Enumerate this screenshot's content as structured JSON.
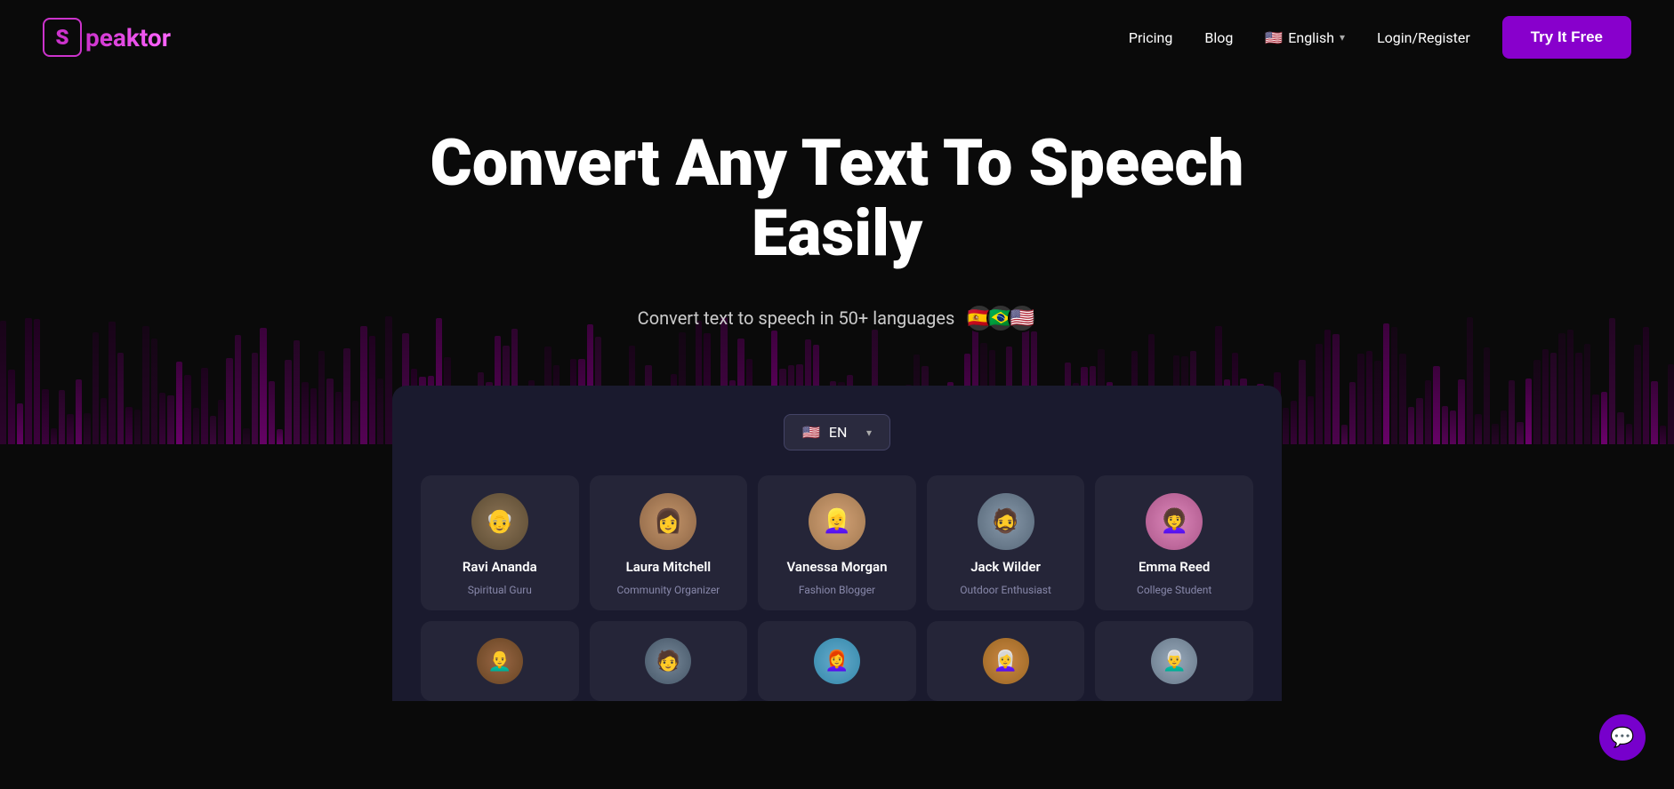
{
  "nav": {
    "logo_letter": "S",
    "logo_name": "peaktor",
    "pricing_label": "Pricing",
    "blog_label": "Blog",
    "language_label": "English",
    "login_label": "Login/Register",
    "try_free_label": "Try It Free",
    "flag_emoji": "🇺🇸"
  },
  "hero": {
    "title": "Convert Any Text To Speech Easily",
    "subtitle": "Convert text to speech in 50+ languages",
    "flags": [
      "🇪🇸",
      "🇧🇷",
      "🇺🇸"
    ]
  },
  "app_panel": {
    "lang_selector": {
      "flag": "🇺🇸",
      "code": "EN"
    },
    "voice_row1": [
      {
        "id": "ravi",
        "name": "Ravi Ananda",
        "title": "Spiritual Guru",
        "emoji": "👴"
      },
      {
        "id": "laura",
        "name": "Laura Mitchell",
        "title": "Community Organizer",
        "emoji": "👩"
      },
      {
        "id": "vanessa",
        "name": "Vanessa Morgan",
        "title": "Fashion Blogger",
        "emoji": "👱‍♀️"
      },
      {
        "id": "jack",
        "name": "Jack Wilder",
        "title": "Outdoor Enthusiast",
        "emoji": "🧔"
      },
      {
        "id": "emma",
        "name": "Emma Reed",
        "title": "College Student",
        "emoji": "👩‍🦱"
      }
    ],
    "voice_row2": [
      {
        "id": "p1",
        "emoji": "👨‍🦲"
      },
      {
        "id": "p2",
        "emoji": "🧑"
      },
      {
        "id": "p3",
        "emoji": "👩‍🦰"
      },
      {
        "id": "p4",
        "emoji": "👩‍🦳"
      },
      {
        "id": "p5",
        "emoji": "👨‍🦳"
      }
    ]
  },
  "chat": {
    "icon": "💬"
  }
}
